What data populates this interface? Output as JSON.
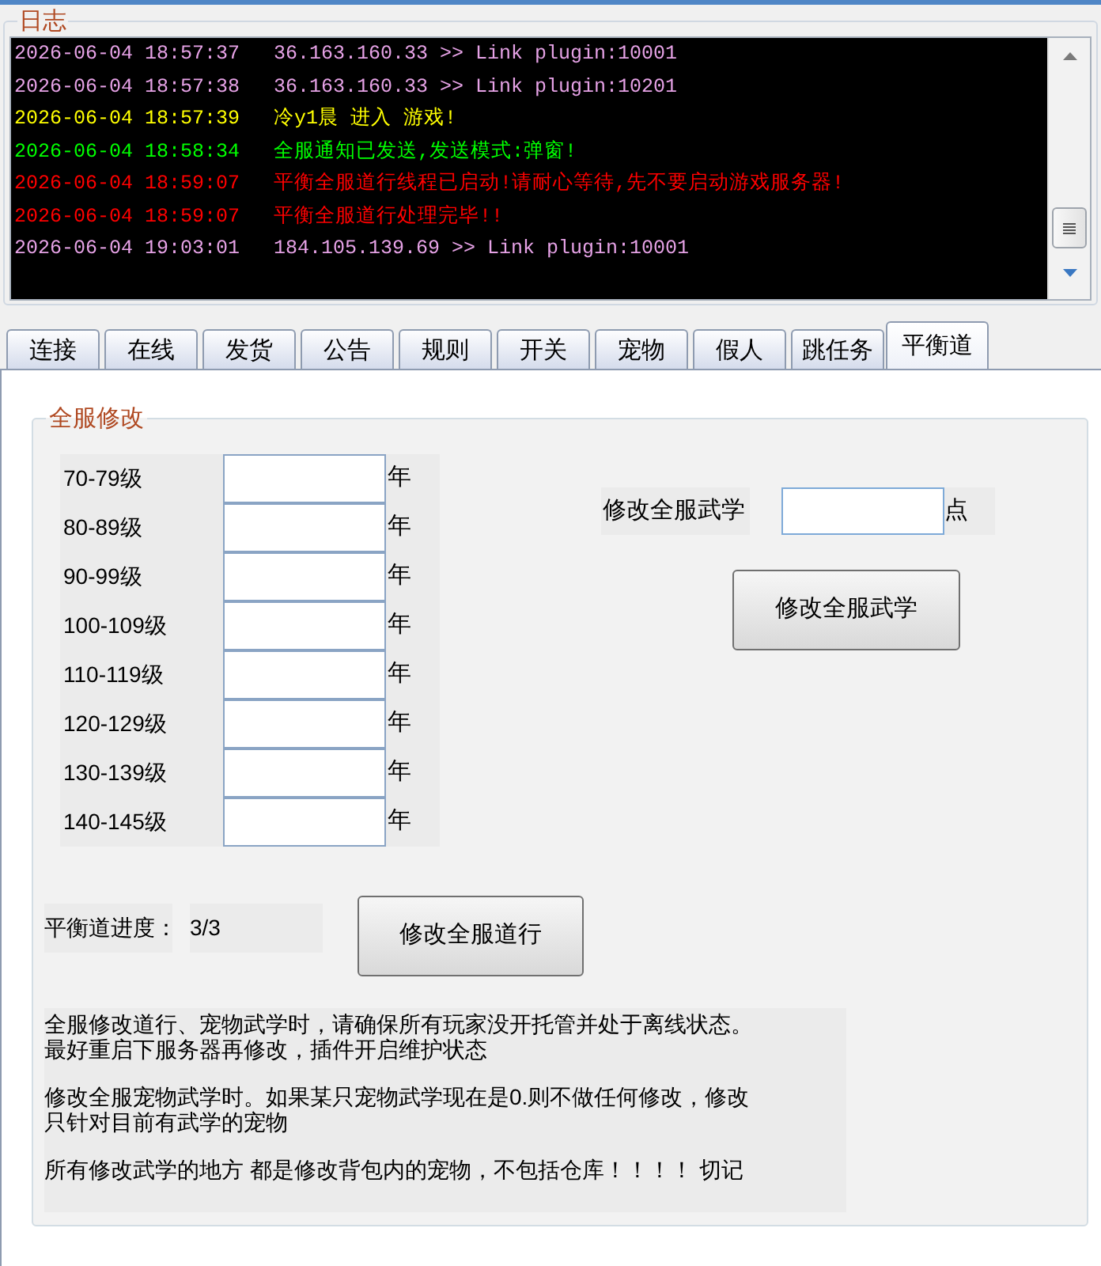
{
  "log": {
    "title": "日志",
    "lines": [
      {
        "time": "2026-06-04 18:57:37",
        "message": "36.163.160.33 >> Link plugin:10001",
        "color": "#e6a2e6"
      },
      {
        "time": "2026-06-04 18:57:38",
        "message": "36.163.160.33 >> Link plugin:10201",
        "color": "#e6a2e6"
      },
      {
        "time": "2026-06-04 18:57:39",
        "message": "冷y1晨 进入 游戏!",
        "color": "#ffff00"
      },
      {
        "time": "2026-06-04 18:58:34",
        "message": "全服通知已发送,发送模式:弹窗!",
        "color": "#00ff00"
      },
      {
        "time": "2026-06-04 18:59:07",
        "message": "平衡全服道行线程已启动!请耐心等待,先不要启动游戏服务器!",
        "color": "#ff0000"
      },
      {
        "time": "2026-06-04 18:59:07",
        "message": "平衡全服道行处理完毕!!",
        "color": "#ff0000"
      },
      {
        "time": "2026-06-04 19:03:01",
        "message": "184.105.139.69 >> Link plugin:10001",
        "color": "#e6a2e6"
      }
    ]
  },
  "tabs": [
    {
      "label": "连接",
      "selected": false
    },
    {
      "label": "在线",
      "selected": false
    },
    {
      "label": "发货",
      "selected": false
    },
    {
      "label": "公告",
      "selected": false
    },
    {
      "label": "规则",
      "selected": false
    },
    {
      "label": "开关",
      "selected": false
    },
    {
      "label": "宠物",
      "selected": false
    },
    {
      "label": "假人",
      "selected": false
    },
    {
      "label": "跳任务",
      "selected": false
    },
    {
      "label": "平衡道",
      "selected": true
    }
  ],
  "panel": {
    "title": "全服修改",
    "levels": [
      {
        "label": "70-79级",
        "unit": "年"
      },
      {
        "label": "80-89级",
        "unit": "年"
      },
      {
        "label": "90-99级",
        "unit": "年"
      },
      {
        "label": "100-109级",
        "unit": "年"
      },
      {
        "label": "110-119级",
        "unit": "年"
      },
      {
        "label": "120-129级",
        "unit": "年"
      },
      {
        "label": "130-139级",
        "unit": "年"
      },
      {
        "label": "140-145级",
        "unit": "年"
      }
    ],
    "skill": {
      "label": "修改全服武学",
      "unit": "点",
      "button": "修改全服武学"
    },
    "progress": {
      "label": "平衡道进度：",
      "value": "3/3",
      "button": "修改全服道行"
    },
    "notes": [
      "全服修改道行、宠物武学时，请确保所有玩家没开托管并处于离线状态。最好重启下服务器再修改，插件开启维护状态",
      "修改全服宠物武学时。如果某只宠物武学现在是0.则不做任何修改，修改只针对目前有武学的宠物",
      "所有修改武学的地方 都是修改背包内的宠物，不包括仓库！！！！ 切记"
    ]
  }
}
